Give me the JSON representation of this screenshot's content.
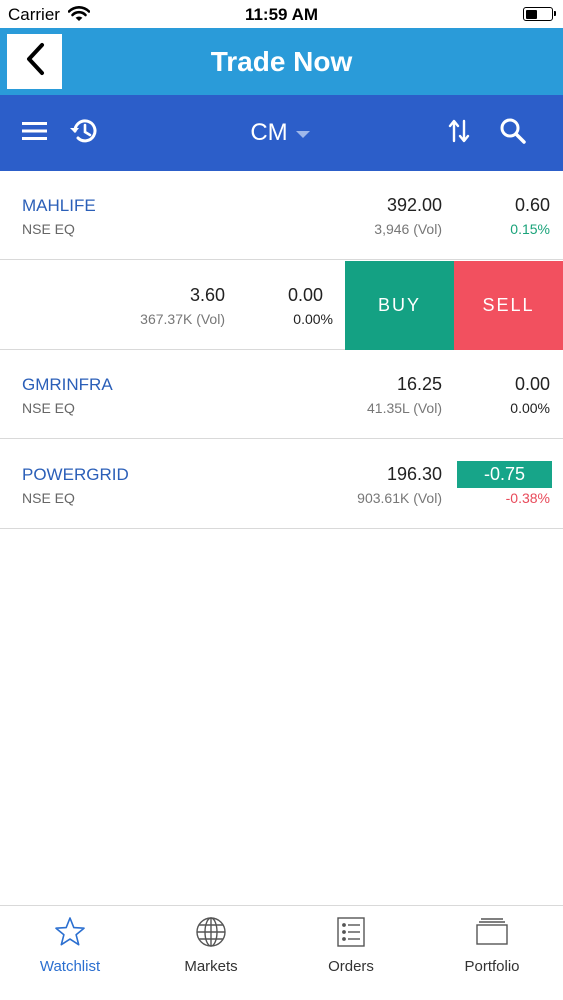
{
  "status_bar": {
    "carrier": "Carrier",
    "time": "11:59 AM",
    "battery_level": 0.45
  },
  "header": {
    "title": "Trade Now",
    "back_icon": "chevron-left-icon"
  },
  "toolbar": {
    "segment": "CM",
    "icons": [
      "menu-icon",
      "history-icon",
      "sort-icon",
      "search-icon"
    ]
  },
  "watchlist": [
    {
      "symbol": "MAHLIFE",
      "exchange": "NSE EQ",
      "ltp": "392.00",
      "volume": "3,946 (Vol)",
      "change": "0.60",
      "change_pct": "0.15%"
    },
    {
      "symbol": "",
      "exchange": "",
      "ltp": "3.60",
      "volume": "367.37K (Vol)",
      "change": "0.00",
      "change_pct": "0.00%",
      "buy_label": "BUY",
      "sell_label": "SELL"
    },
    {
      "symbol": "GMRINFRA",
      "exchange": "NSE EQ",
      "ltp": "16.25",
      "volume": "41.35L (Vol)",
      "change": "0.00",
      "change_pct": "0.00%"
    },
    {
      "symbol": "POWERGRID",
      "exchange": "NSE EQ",
      "ltp": "196.30",
      "volume": "903.61K (Vol)",
      "change": "-0.75",
      "change_pct": "-0.38%"
    }
  ],
  "tab_bar": {
    "tabs": [
      {
        "label": "Watchlist",
        "icon": "star-icon",
        "active": true
      },
      {
        "label": "Markets",
        "icon": "globe-icon"
      },
      {
        "label": "Orders",
        "icon": "orders-list-icon"
      },
      {
        "label": "Portfolio",
        "icon": "portfolio-icon"
      }
    ]
  },
  "colors": {
    "header": "#2a9bd9",
    "toolbar": "#2c5ec9",
    "buy": "#14a183",
    "sell": "#f2505f",
    "positive": "#1aa37a",
    "negative": "#e84a5a",
    "active_tab": "#2b6fd0"
  }
}
